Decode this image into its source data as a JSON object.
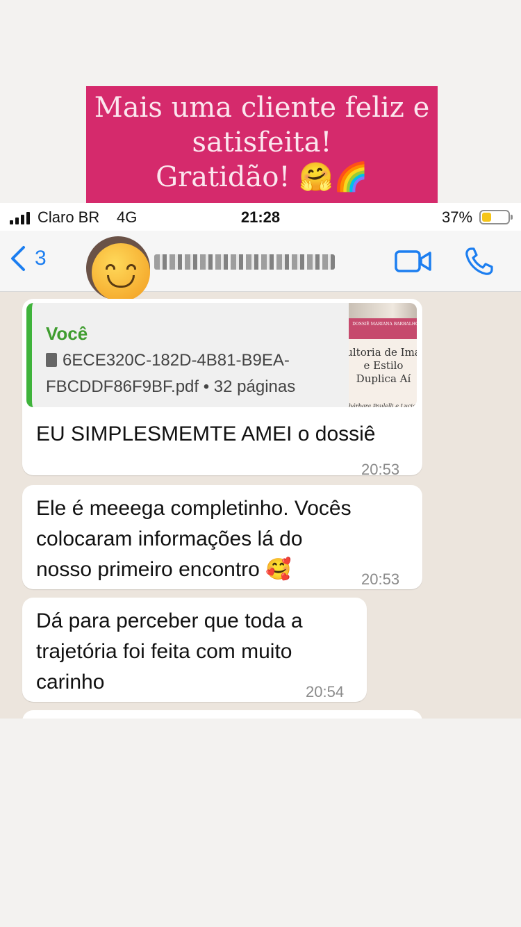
{
  "banner": {
    "line1": "Mais uma cliente feliz e",
    "line2": "satisfeita!",
    "line3": "Gratidão! 🤗🌈"
  },
  "status_bar": {
    "carrier": "Claro BR",
    "network": "4G",
    "time": "21:28",
    "battery_percent": "37%",
    "battery_level": 0.37
  },
  "nav": {
    "back_count": "3",
    "avatar_icon": "smiling-emoji",
    "video_icon": "video-camera-icon",
    "call_icon": "phone-icon",
    "accent_color": "#1c7ef0"
  },
  "messages": [
    {
      "quote": {
        "author": "Você",
        "file_name": "6ECE320C-182D-4B81-B9EA-FBCDDF86F9BF.pdf • 32 páginas",
        "thumb_band": "DOSSIÊ MARIANA BARBALHO",
        "thumb_title1": "ultoria de Ima",
        "thumb_title2": "e Estilo",
        "thumb_title3": "Duplica Aí",
        "thumb_authors": "bárbara Paulelli e Luciana Paulel"
      },
      "text": "EU SIMPLESMEMTE AMEI o dossiê",
      "time": "20:53"
    },
    {
      "line1": "Ele é meeega completinho. Vocês",
      "line2": "colocaram informações lá do",
      "line3": "nosso primeiro encontro 🥰",
      "time": "20:53"
    },
    {
      "line1": "Dá para perceber que toda a",
      "line2": "trajetória foi feita com muito",
      "line3": "carinho",
      "time": "20:54"
    }
  ],
  "colors": {
    "banner_bg": "#d52a6c",
    "quote_bar": "#3fb33b",
    "chat_bg": "#ece5dd"
  }
}
